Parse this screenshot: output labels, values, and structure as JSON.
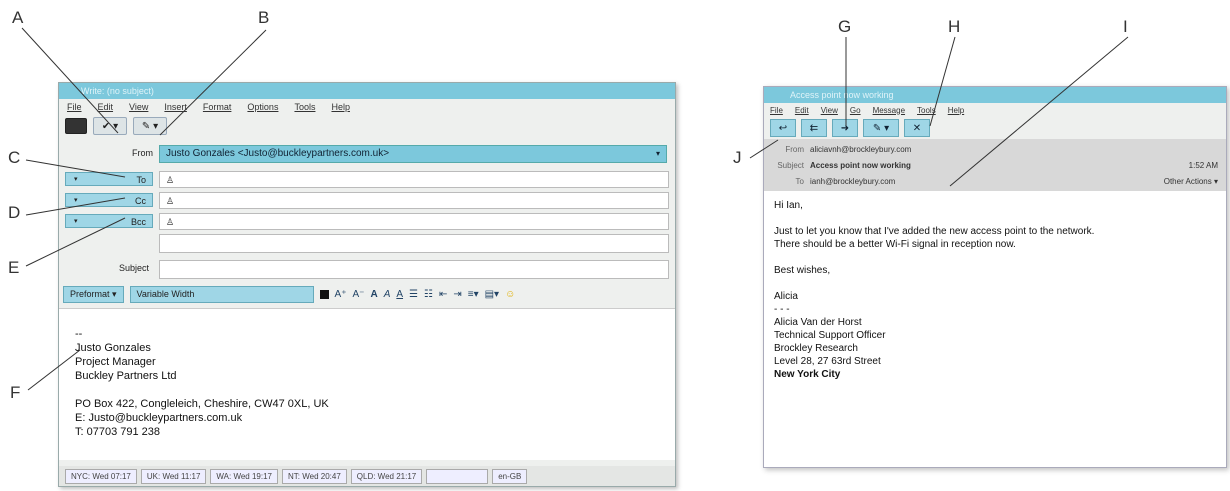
{
  "callouts": {
    "a": "A",
    "b": "B",
    "c": "C",
    "d": "D",
    "e": "E",
    "f": "F",
    "g": "G",
    "h": "H",
    "i": "I",
    "j": "J"
  },
  "compose": {
    "title": "Write: (no subject)",
    "menu": [
      "File",
      "Edit",
      "View",
      "Insert",
      "Format",
      "Options",
      "Tools",
      "Help"
    ],
    "from_label": "From",
    "from_value": "Justo Gonzales <Justo@buckleypartners.com.uk>",
    "to_label": "To",
    "cc_label": "Cc",
    "bcc_label": "Bcc",
    "subject_label": "Subject",
    "subject_value": "",
    "paragraph_format": "Preformat",
    "font": "Variable Width",
    "signature": [
      "-- ",
      "Justo Gonzales",
      "Project Manager",
      "Buckley Partners Ltd",
      "",
      "PO Box 422, Congleleich, Cheshire, CW47 0XL, UK",
      "E:  Justo@buckleypartners.com.uk",
      "T:  07703 791 238"
    ],
    "status_cells": [
      "NYC: Wed 07:17",
      "UK: Wed 11:17",
      "WA: Wed 19:17",
      "NT: Wed 20:47",
      "QLD: Wed 21:17",
      "",
      "en-GB"
    ]
  },
  "reader": {
    "title": "Access point now working",
    "menu": [
      "File",
      "Edit",
      "View",
      "Go",
      "Message",
      "Tools",
      "Help"
    ],
    "from_label": "From",
    "from_value": "aliciavnh@brockleybury.com",
    "subject_label": "Subject",
    "subject_value": "Access point now working",
    "time": "1:52 AM",
    "to_label": "To",
    "to_value": "ianh@brockleybury.com",
    "other_actions": "Other Actions",
    "body": [
      "Hi Ian,",
      "",
      "Just to let you know that I've added the new access point to the network.",
      "There should be a better Wi-Fi signal in reception now.",
      "",
      "Best wishes,",
      "",
      "Alicia",
      "- - -",
      "Alicia Van der Horst",
      "Technical Support Officer",
      "Brockley Research",
      "Level 28, 27 63rd Street",
      "New York City"
    ]
  }
}
